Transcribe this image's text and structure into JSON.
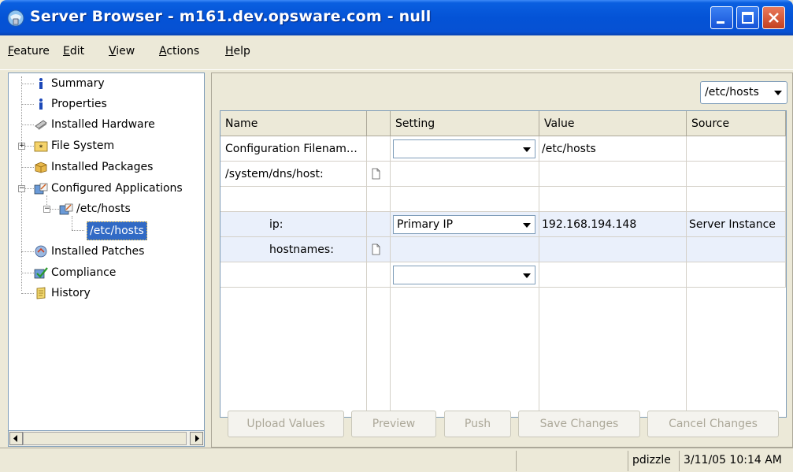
{
  "window": {
    "title": "Server Browser - m161.dev.opsware.com - null"
  },
  "menu": [
    {
      "label": "Feature"
    },
    {
      "label": "Edit"
    },
    {
      "label": "View"
    },
    {
      "label": "Actions"
    },
    {
      "label": "Help"
    }
  ],
  "tree": {
    "items": [
      {
        "label": "Summary",
        "icon": "info-icon"
      },
      {
        "label": "Properties",
        "icon": "info-icon"
      },
      {
        "label": "Installed Hardware",
        "icon": "hardware-icon"
      },
      {
        "label": "File System",
        "icon": "folder-icon"
      },
      {
        "label": "Installed Packages",
        "icon": "package-icon"
      },
      {
        "label": "Configured Applications",
        "icon": "app-config-icon"
      },
      {
        "label": "/etc/hosts",
        "icon": "app-config-icon"
      },
      {
        "label": "/etc/hosts",
        "icon": "none",
        "selected": true
      },
      {
        "label": "Installed Patches",
        "icon": "patch-icon"
      },
      {
        "label": "Compliance",
        "icon": "check-icon"
      },
      {
        "label": "History",
        "icon": "history-icon"
      }
    ]
  },
  "file_selector": {
    "value": "/etc/hosts"
  },
  "grid": {
    "headers": [
      "Name",
      "",
      "Setting",
      "Value",
      "Source"
    ],
    "rows": [
      {
        "name": "Configuration Filenam…",
        "setting": "",
        "value": "/etc/hosts",
        "source": ""
      },
      {
        "name": "/system/dns/host:",
        "setting": "",
        "value": "",
        "source": ""
      },
      {
        "name": "",
        "setting": "",
        "value": "",
        "source": ""
      },
      {
        "name": "ip:",
        "setting": "Primary IP",
        "value": "192.168.194.148",
        "source": "Server Instance"
      },
      {
        "name": "hostnames:",
        "setting": "",
        "value": "",
        "source": ""
      },
      {
        "name": "",
        "setting": "",
        "value": "",
        "source": ""
      }
    ]
  },
  "buttons": {
    "upload": "Upload Values",
    "preview": "Preview",
    "push": "Push",
    "save": "Save Changes",
    "cancel": "Cancel Changes"
  },
  "status": {
    "user": "pdizzle",
    "datetime": "3/11/05 10:14 AM"
  },
  "colors": {
    "titlebar": "#0453d6",
    "selection": "#316ac5",
    "highlight_row": "#eaf0fb"
  }
}
